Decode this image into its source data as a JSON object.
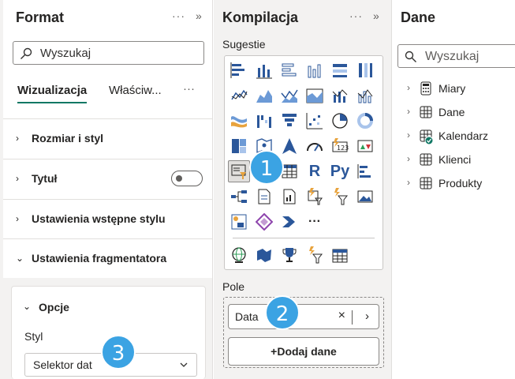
{
  "format": {
    "title": "Format",
    "more": "···",
    "collapse": "»",
    "search_placeholder": "Wyszukaj",
    "tabs": [
      {
        "label": "Wizualizacja",
        "active": true
      },
      {
        "label": "Właściw..."
      }
    ],
    "tabs_more": "···",
    "sections": [
      {
        "label": "Rozmiar i styl",
        "chevron": "›"
      },
      {
        "label": "Tytuł",
        "chevron": "›",
        "toggle": "off"
      },
      {
        "label": "Ustawienia wstępne stylu",
        "chevron": "›"
      },
      {
        "label": "Ustawienia fragmentatora",
        "chevron": "⌄"
      }
    ],
    "options": {
      "label": "Opcje",
      "style_label": "Styl",
      "style_value": "Selektor dat"
    }
  },
  "kompilacja": {
    "title": "Kompilacja",
    "more": "···",
    "collapse": "»",
    "suggestions_label": "Sugestie",
    "r_visual": "R",
    "python_visual": "Py",
    "more_visuals": "···",
    "fields_label": "Pole",
    "field_value": "Data",
    "remove_symbol": "×",
    "expand_symbol": "›",
    "add_data": "+Dodaj dane"
  },
  "dane": {
    "title": "Dane",
    "search_placeholder": "Wyszukaj",
    "tables": [
      {
        "label": "Miary",
        "icon": "calculator-icon"
      },
      {
        "label": "Dane",
        "icon": "table-icon"
      },
      {
        "label": "Kalendarz",
        "icon": "calendar-table-icon"
      },
      {
        "label": "Klienci",
        "icon": "table-icon"
      },
      {
        "label": "Produkty",
        "icon": "table-icon"
      }
    ]
  },
  "callouts": [
    "1",
    "2",
    "3"
  ],
  "colors": {
    "accent": "#117865",
    "callout": "#3ba3e3",
    "viz_blue": "#2b579a",
    "viz_orange": "#e8a33d"
  }
}
